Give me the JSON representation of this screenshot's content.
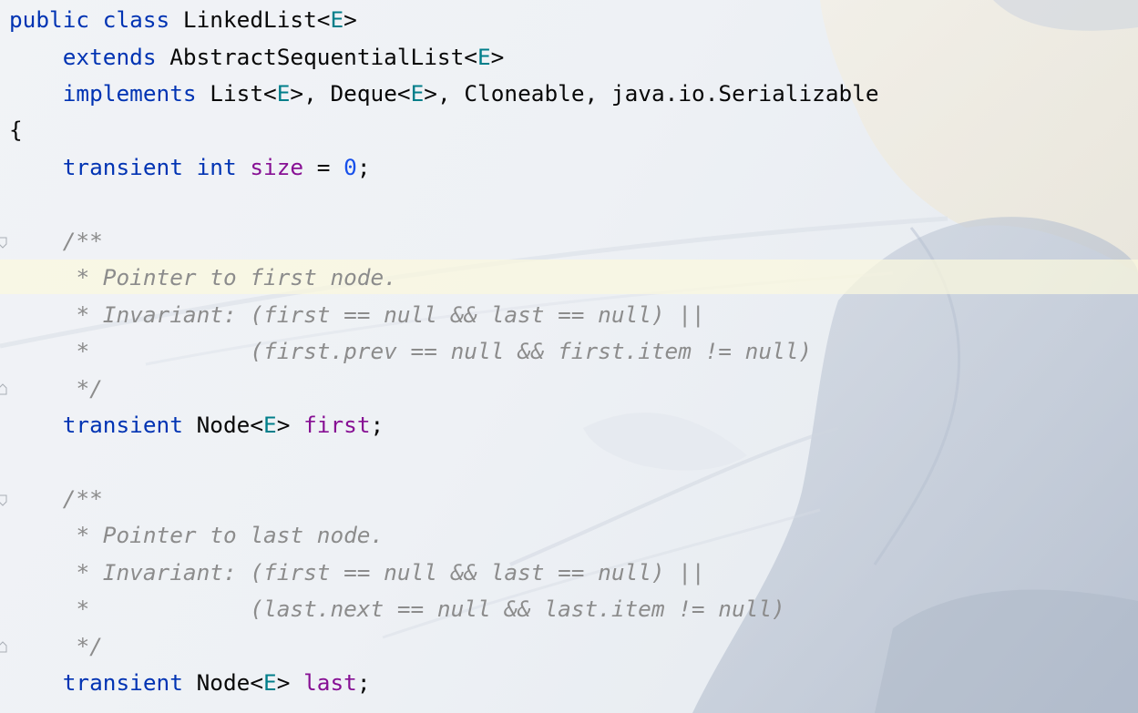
{
  "editor": {
    "language": "Java",
    "current_line_highlight": "#fbf8de",
    "colors": {
      "keyword": "#0033b3",
      "type_param": "#007e8a",
      "field": "#871094",
      "number": "#1750eb",
      "comment": "#8c8c8c",
      "text": "#080808"
    },
    "lines": [
      "public class LinkedList<E>",
      "    extends AbstractSequentialList<E>",
      "    implements List<E>, Deque<E>, Cloneable, java.io.Serializable",
      "{",
      "    transient int size = 0;",
      "",
      "    /**",
      "     * Pointer to first node.",
      "     * Invariant: (first == null && last == null) ||",
      "     *            (first.prev == null && first.item != null)",
      "     */",
      "    transient Node<E> first;",
      "",
      "    /**",
      "     * Pointer to last node.",
      "     * Invariant: (first == null && last == null) ||",
      "     *            (last.next == null && last.item != null)",
      "     */",
      "    transient Node<E> last;"
    ],
    "tokens": {
      "public": "public",
      "class": "class",
      "linkedlist": "LinkedList",
      "extends": "extends",
      "abstractsequentiallist": "AbstractSequentialList",
      "implements": "implements",
      "list": "List",
      "deque": "Deque",
      "cloneable": "Cloneable",
      "serializable": "java.io.Serializable",
      "transient": "transient",
      "int": "int",
      "size": "size",
      "zero": "0",
      "node": "Node",
      "e": "E",
      "first": "first",
      "last": "last",
      "open_brace": "{",
      "comment_open": "/**",
      "comment_close": "*/",
      "comment_first_1": "* Pointer to first node.",
      "comment_first_2": "* Invariant: (first == null && last == null) ||",
      "comment_first_3": "*            (first.prev == null && first.item != null)",
      "comment_last_1": "* Pointer to last node.",
      "comment_last_2": "* Invariant: (first == null && last == null) ||",
      "comment_last_3": "*            (last.next == null && last.item != null)"
    }
  }
}
